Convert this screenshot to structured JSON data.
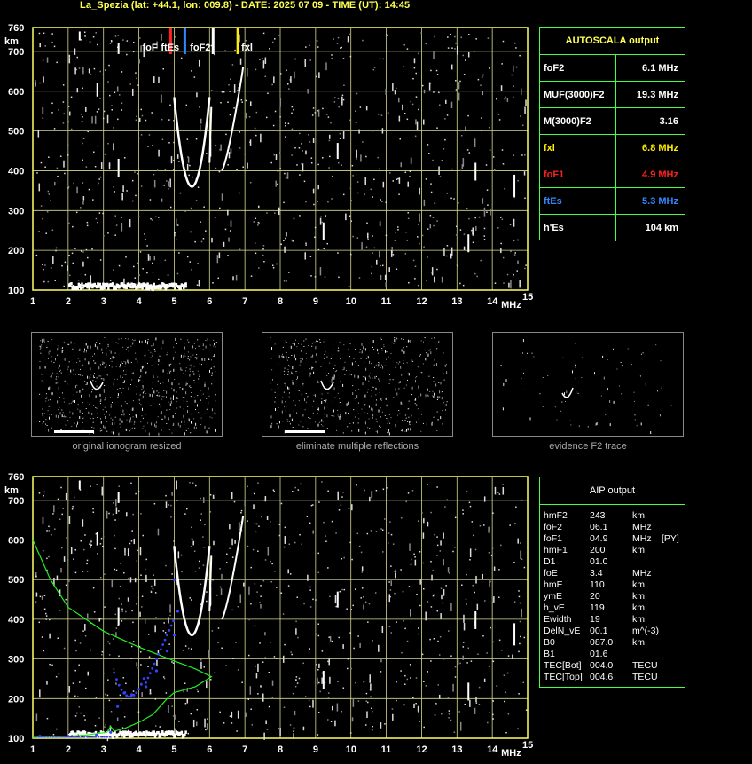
{
  "header": {
    "title": "La_Spezia (lat: +44.1, lon: 009.8) - DATE: 2025 07 09 - TIME (UT): 14:45"
  },
  "axes": {
    "y_unit": "km",
    "x_unit": "MHz",
    "y_ticks": [
      "760",
      "700",
      "600",
      "500",
      "400",
      "300",
      "200",
      "100"
    ],
    "x_ticks": [
      "1",
      "2",
      "3",
      "4",
      "5",
      "6",
      "7",
      "8",
      "9",
      "10",
      "11",
      "12",
      "13",
      "14",
      "15"
    ]
  },
  "markers": [
    {
      "label": "foF",
      "color": "#ff2020",
      "freq": 4.9
    },
    {
      "label": "ftEs",
      "color": "#3388ff",
      "freq": 5.3
    },
    {
      "label": "foF2",
      "color": "#ffffff",
      "freq": 6.1
    },
    {
      "label": "fxl",
      "color": "#ffee00",
      "freq": 6.8
    }
  ],
  "autoscala": {
    "title": "AUTOSCALA output",
    "rows": [
      {
        "label": "foF2",
        "value": "6.1 MHz",
        "color": "#ffffff"
      },
      {
        "label": "MUF(3000)F2",
        "value": "19.3 MHz",
        "color": "#ffffff"
      },
      {
        "label": "M(3000)F2",
        "value": "3.16",
        "color": "#ffffff"
      },
      {
        "label": "fxl",
        "value": "6.8 MHz",
        "color": "#ffee00"
      },
      {
        "label": "foF1",
        "value": "4.9 MHz",
        "color": "#ff2020"
      },
      {
        "label": "ftEs",
        "value": "5.3 MHz",
        "color": "#3388ff"
      },
      {
        "label": "h'Es",
        "value": "104     km",
        "color": "#ffffff"
      }
    ]
  },
  "thumbnails": {
    "caption1": "original ionogram resized",
    "caption2": "eliminate multiple reflections",
    "caption3": "evidence F2 trace"
  },
  "aip": {
    "title": "AIP output",
    "rows": [
      {
        "name": "hmF2",
        "value": "243",
        "unit": "km",
        "flag": ""
      },
      {
        "name": "foF2",
        "value": "06.1",
        "unit": "MHz",
        "flag": ""
      },
      {
        "name": "foF1",
        "value": "04.9",
        "unit": "MHz",
        "flag": "[PY]"
      },
      {
        "name": "hmF1",
        "value": "200",
        "unit": "km",
        "flag": ""
      },
      {
        "name": "D1",
        "value": "01.0",
        "unit": "",
        "flag": ""
      },
      {
        "name": "foE",
        "value": "3.4",
        "unit": "MHz",
        "flag": ""
      },
      {
        "name": "hmE",
        "value": "110",
        "unit": "km",
        "flag": ""
      },
      {
        "name": "ymE",
        "value": "20",
        "unit": "km",
        "flag": ""
      },
      {
        "name": "h_vE",
        "value": "119",
        "unit": "km",
        "flag": ""
      },
      {
        "name": "Ewidth",
        "value": "19",
        "unit": "km",
        "flag": ""
      },
      {
        "name": "DelN_vE",
        "value": "00.1",
        "unit": "m^(-3)",
        "flag": ""
      },
      {
        "name": "B0",
        "value": "087.0",
        "unit": "km",
        "flag": ""
      },
      {
        "name": "B1",
        "value": "01.6",
        "unit": "",
        "flag": ""
      },
      {
        "name": "TEC[Bot]",
        "value": "004.0",
        "unit": "TECU",
        "flag": ""
      },
      {
        "name": "TEC[Top]",
        "value": "004.6",
        "unit": "TECU",
        "flag": ""
      }
    ]
  },
  "colors": {
    "grid": "#d8d890",
    "frame": "#ffff66",
    "panel": "#44ff44",
    "profile": "#22ee22",
    "trace": "#3344ff"
  }
}
